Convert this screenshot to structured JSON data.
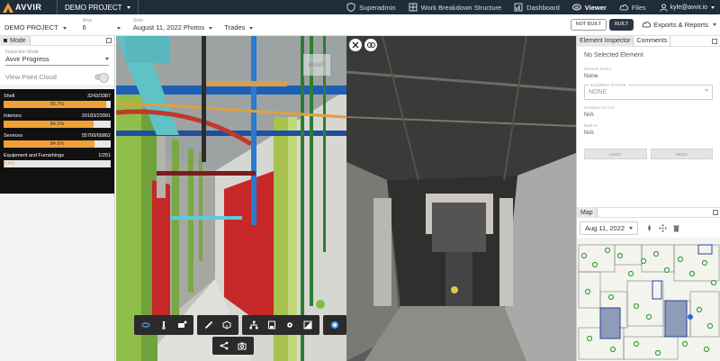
{
  "app": {
    "brand": "AVVIR",
    "project_menu": "DEMO PROJECT"
  },
  "nav": {
    "items": [
      {
        "label": "Superadmin",
        "icon": "shield-icon"
      },
      {
        "label": "Work Breakdown Structure",
        "icon": "grid-icon"
      },
      {
        "label": "Dashboard",
        "icon": "dashboard-icon"
      },
      {
        "label": "Viewer",
        "icon": "360-icon",
        "active": true
      },
      {
        "label": "Files",
        "icon": "cloud-icon"
      }
    ],
    "user_email": "kyle@avvir.io"
  },
  "filters": {
    "project_value": "DEMO PROJECT",
    "area_label": "Area",
    "area_value": "6",
    "scan_label": "Scan",
    "scan_value": "August 11, 2022 Photos",
    "trades_value": "Trades",
    "not_built_label": "NOT BUILT",
    "built_label": "BUILT",
    "exports_label": "Exports & Reports"
  },
  "left_panel": {
    "tab_label": "Mode",
    "inspection_mode_label": "Inspection Mode",
    "inspection_mode_value": "Avvir Progress",
    "point_cloud_label": "View Point Cloud",
    "progress": [
      {
        "name": "Shell",
        "count": "3243/3387",
        "percent_label": "95.7%",
        "fraction": 0.957
      },
      {
        "name": "Interiors",
        "count": "20183/23991",
        "percent_label": "84.1%",
        "fraction": 0.841
      },
      {
        "name": "Services",
        "count": "55700/65862",
        "percent_label": "84.6%",
        "fraction": 0.846
      },
      {
        "name": "Equipment and Furnishings",
        "count": "1/251",
        "percent_label": "0.4%",
        "fraction": 0.004
      }
    ]
  },
  "viewer": {
    "right_marker": "RIGHT"
  },
  "right_panel": {
    "tabs": [
      "Element Inspector",
      "Comments"
    ],
    "title": "No Selected Element",
    "element_errors_label": "Element Errors",
    "element_errors_value": "None",
    "element_status_label": "ELEMENT STATUS",
    "element_status_value": "NONE",
    "deviation_label": "Deviation (X,Y,Z)",
    "deviation_value": "N/A",
    "built_at_label": "Built At",
    "built_at_value": "N/A",
    "undo_label": "UNDO",
    "redo_label": "REDO",
    "map_tab": "Map",
    "map_date": "Aug 11, 2022"
  },
  "colors": {
    "topbar": "#1f2d3a",
    "progress_fill": "#f0a034",
    "toolbar": "#2b2b2b"
  }
}
